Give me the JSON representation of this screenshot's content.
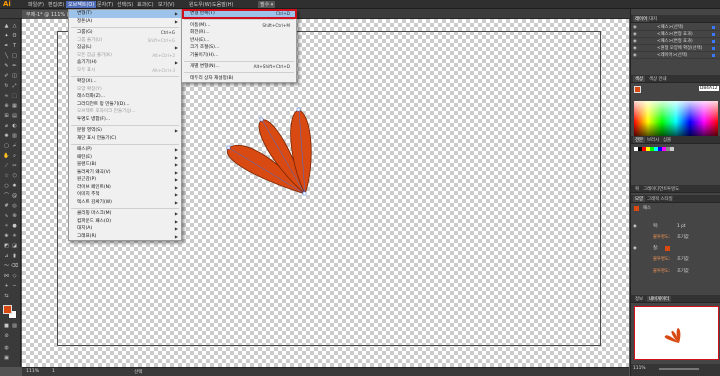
{
  "app": {
    "logo": "Ai"
  },
  "menubar": {
    "items": [
      "파일(F)",
      "편집(E)",
      "오브젝트(O)",
      "문자(T)",
      "선택(S)",
      "효과(C)",
      "보기(V)",
      "윈도우(W)",
      "도움말(H)"
    ],
    "mode": "필수 ▾"
  },
  "document": {
    "tab": "무제-1* @ 111% (RGB/미리 보기)"
  },
  "status": {
    "zoom": "111%",
    "page": "1",
    "tool": "선택"
  },
  "object_menu": {
    "items": [
      {
        "label": "변형(T)",
        "shortcut": "",
        "submenu": true,
        "highlight": true
      },
      {
        "label": "정돈(A)",
        "shortcut": "",
        "submenu": true
      },
      {
        "sep": true
      },
      {
        "label": "그룹(G)",
        "shortcut": "Ctrl+G"
      },
      {
        "label": "그룹 풀기(U)",
        "shortcut": "Shift+Ctrl+G",
        "disabled": true
      },
      {
        "label": "잠금(L)",
        "shortcut": "",
        "submenu": true
      },
      {
        "label": "모든 잠금 풀기(K)",
        "shortcut": "Alt+Ctrl+2",
        "disabled": true
      },
      {
        "label": "숨기기(H)",
        "shortcut": "",
        "submenu": true
      },
      {
        "label": "모두 표시",
        "shortcut": "Alt+Ctrl+3",
        "disabled": true
      },
      {
        "sep": true
      },
      {
        "label": "확장(X)...",
        "shortcut": ""
      },
      {
        "label": "모양 확장(Y)",
        "shortcut": "",
        "disabled": true
      },
      {
        "label": "래스터화(Z)...",
        "shortcut": ""
      },
      {
        "label": "그라디언트 망 만들기(D)...",
        "shortcut": ""
      },
      {
        "label": "오브젝트 모자이크 만들기(J)...",
        "shortcut": "",
        "disabled": true
      },
      {
        "label": "투명도 병합(F)...",
        "shortcut": ""
      },
      {
        "sep": true
      },
      {
        "label": "분할 영역(S)",
        "shortcut": "",
        "submenu": true
      },
      {
        "label": "재단 표시 만들기(C)",
        "shortcut": ""
      },
      {
        "sep": true
      },
      {
        "label": "패스(P)",
        "shortcut": "",
        "submenu": true
      },
      {
        "label": "패턴(E)",
        "shortcut": "",
        "submenu": true
      },
      {
        "label": "블렌드(B)",
        "shortcut": "",
        "submenu": true
      },
      {
        "label": "둘러싸기 왜곡(V)",
        "shortcut": "",
        "submenu": true
      },
      {
        "label": "원근감(P)",
        "shortcut": "",
        "submenu": true
      },
      {
        "label": "라이브 페인트(N)",
        "shortcut": "",
        "submenu": true
      },
      {
        "label": "이미지 추적",
        "shortcut": "",
        "submenu": true
      },
      {
        "label": "텍스트 감싸기(W)",
        "shortcut": "",
        "submenu": true
      },
      {
        "sep": true
      },
      {
        "label": "클리핑 마스크(M)",
        "shortcut": "",
        "submenu": true
      },
      {
        "label": "컴파운드 패스(O)",
        "shortcut": "",
        "submenu": true
      },
      {
        "label": "대지(A)",
        "shortcut": "",
        "submenu": true
      },
      {
        "label": "그래프(R)",
        "shortcut": "",
        "submenu": true
      }
    ]
  },
  "transform_menu": {
    "items": [
      {
        "label": "변형 반복(T)",
        "shortcut": "Ctrl+D",
        "highlight": true
      },
      {
        "sep": true
      },
      {
        "label": "이동(M)...",
        "shortcut": "Shift+Ctrl+M"
      },
      {
        "label": "회전(R)...",
        "shortcut": ""
      },
      {
        "label": "반사(E)...",
        "shortcut": ""
      },
      {
        "label": "크기 조절(S)...",
        "shortcut": ""
      },
      {
        "label": "기울이기(H)...",
        "shortcut": ""
      },
      {
        "sep": true
      },
      {
        "label": "개별 변형(N)...",
        "shortcut": "Alt+Shift+Ctrl+D"
      },
      {
        "sep": true
      },
      {
        "label": "테두리 상자 재설정(B)",
        "shortcut": ""
      }
    ]
  },
  "panels": {
    "layers_tabs": [
      "레이어",
      "대지"
    ],
    "layer_rows": [
      {
        "label": "<패스>(선택)"
      },
      {
        "label": "<패스>(변형 효과)"
      },
      {
        "label": "<패스>(변형 효과)"
      },
      {
        "label": "<원형 모양에 확장(선택)"
      },
      {
        "label": "<레이어>(선택)"
      }
    ],
    "color_tabs": [
      "색상",
      "색상 안내"
    ],
    "hex": "D84A12",
    "swatch_tabs": [
      "견본",
      "브러시",
      "심볼"
    ],
    "appearance_tabs": [
      "획",
      "그레이디언트",
      "투명도"
    ],
    "appearance_header": [
      "모양",
      "그래픽 스타일"
    ],
    "appearance_rows": [
      {
        "label": "패스"
      },
      {
        "label": "획:",
        "value": "1 pt"
      },
      {
        "label": "불투명도:",
        "value": "초기값"
      },
      {
        "label": "칠:"
      },
      {
        "label": "불투명도:",
        "value": "초기값"
      },
      {
        "label": "불투명도:",
        "value": "초기값"
      }
    ],
    "nav_tabs": [
      "정보",
      "내비게이터"
    ],
    "nav_zoom": "111%"
  },
  "colors": {
    "petal": "#D84A12",
    "accent_menu": "#9DC3EA",
    "highlight_box": "#D1101E"
  }
}
